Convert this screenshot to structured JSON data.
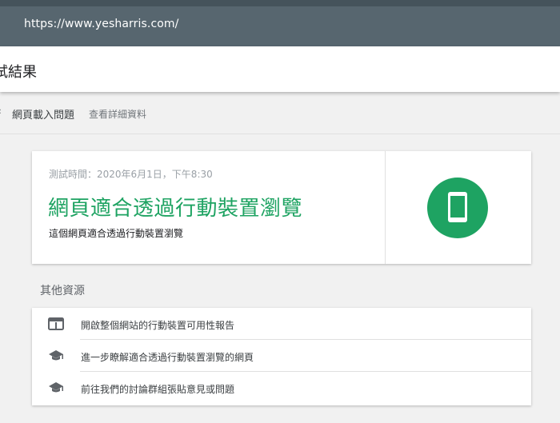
{
  "browser": {
    "url": "https://www.yesharris.com/"
  },
  "page": {
    "title": "試結果"
  },
  "issues": {
    "label": "網頁載入問題",
    "details_link": "查看詳細資料"
  },
  "result": {
    "test_time": "測試時間：2020年6月1日，下午8:30",
    "headline": "網頁適合透過行動裝置瀏覽",
    "subtitle": "這個網頁適合透過行動裝置瀏覽",
    "accent_color": "#1ea362",
    "icon": "smartphone-icon"
  },
  "resources": {
    "title": "其他資源",
    "items": [
      {
        "icon": "web-page-icon",
        "label": "開啟整個網站的行動裝置可用性報告"
      },
      {
        "icon": "graduation-cap-icon",
        "label": "進一步瞭解適合透過行動裝置瀏覽的網頁"
      },
      {
        "icon": "graduation-cap-icon",
        "label": "前往我們的討論群組張貼意見或問題"
      }
    ]
  }
}
